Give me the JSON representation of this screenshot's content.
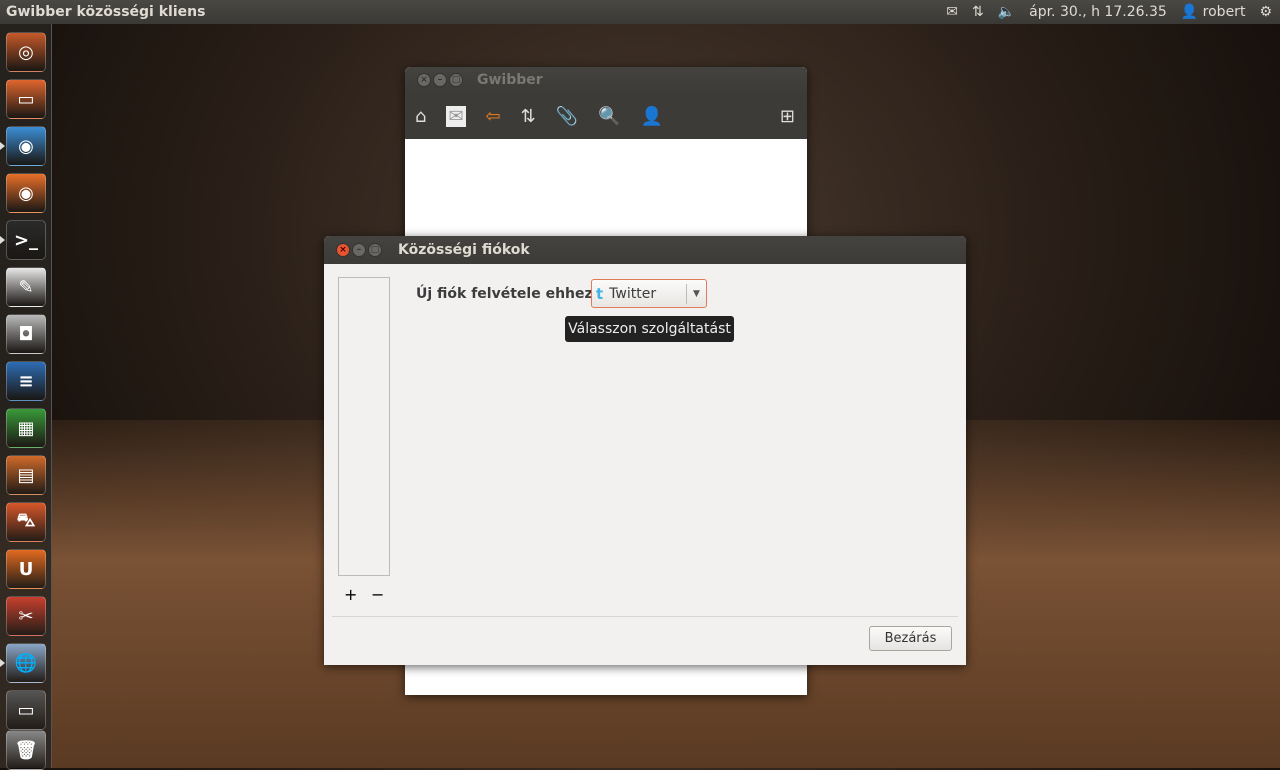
{
  "topbar": {
    "app_title": "Gwibber közösségi kliens",
    "datetime": "ápr. 30., h 17.26.35",
    "user": "robert",
    "icons": [
      "mail-icon",
      "network-icon",
      "volume-icon",
      "user-icon",
      "power-icon"
    ]
  },
  "launcher": {
    "items": [
      "ubuntu-home",
      "files",
      "chrome",
      "firefox",
      "terminal",
      "text-editor",
      "screenshot",
      "writer",
      "calc",
      "impress",
      "software-center",
      "ubuntu-one",
      "system-settings",
      "gwibber",
      "workspaces",
      "trash"
    ]
  },
  "gwibber": {
    "title": "Gwibber",
    "toolbar": [
      "home-icon",
      "messages-icon",
      "replies-icon",
      "retweet-icon",
      "attachment-icon",
      "search-icon",
      "user-icon",
      "compose-icon"
    ]
  },
  "dialog": {
    "title": "Közösségi fiókok",
    "add_label": "Új fiók felvétele ehhez:",
    "service": "Twitter",
    "tooltip": "Válasszon szolgáltatást",
    "add": "+",
    "remove": "−",
    "close": "Bezárás"
  }
}
